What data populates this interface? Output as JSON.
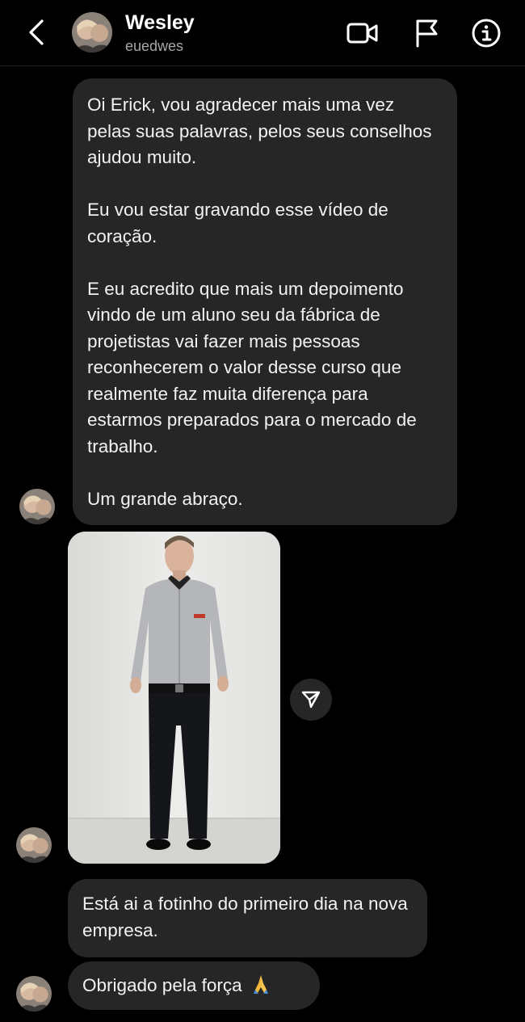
{
  "header": {
    "name": "Wesley",
    "username": "euedwes",
    "icons": [
      "back-chevron-icon",
      "video-call-icon",
      "flag-icon",
      "info-icon"
    ]
  },
  "messages": {
    "m1": {
      "p1": "Oi Erick, vou agradecer mais uma vez pelas suas palavras, pelos seus conselhos ajudou muito.",
      "p2": "Eu vou estar gravando esse vídeo de coração.",
      "p3": "E eu acredito que mais um depoimento vindo de um aluno seu da fábrica de projetistas vai fazer mais pessoas reconhecerem o valor desse curso que realmente faz muita diferença para estarmos preparados para o mercado de trabalho.",
      "p4": "Um grande abraço."
    },
    "photo": {
      "description_icon": "photo-of-man-in-office-shirt"
    },
    "m2": "Está ai a fotinho do primeiro dia na nova empresa.",
    "m3": "Obrigado pela força",
    "m3_emoji": "folded-hands-emoji"
  },
  "colors": {
    "background": "#000000",
    "bubble": "#262626",
    "text": "#f2f2f2",
    "muted": "#a8a8a8"
  }
}
